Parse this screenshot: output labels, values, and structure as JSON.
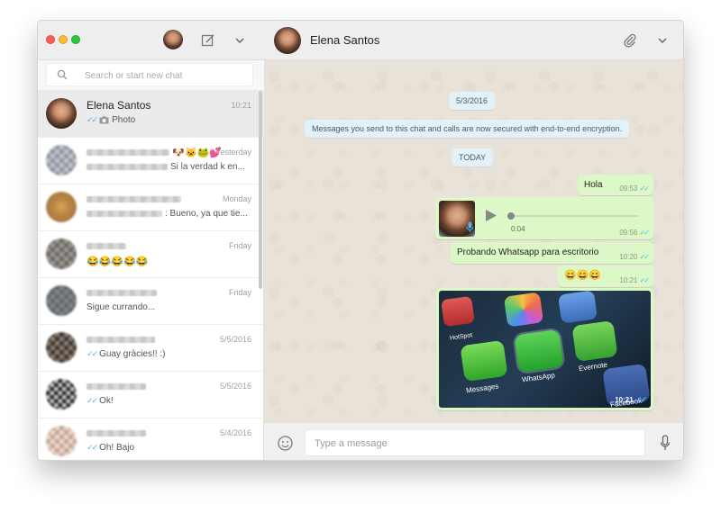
{
  "search": {
    "placeholder": "Search or start new chat"
  },
  "chats": [
    {
      "name": "Elena Santos",
      "time": "10:21",
      "preview": "Photo",
      "ticks": "✓✓",
      "has_photo_icon": true
    },
    {
      "name": "",
      "time": "Yesterday",
      "preview": "Si la verdad k en...",
      "ticks": "",
      "emojis": "🐶🐱🐸💕"
    },
    {
      "name": "",
      "time": "Monday",
      "preview": ": Bueno, ya que tie...",
      "ticks": ""
    },
    {
      "name": "",
      "time": "Friday",
      "preview": "😂😂😂😂😂",
      "ticks": ""
    },
    {
      "name": "",
      "time": "Friday",
      "preview": "Sigue currando...",
      "ticks": ""
    },
    {
      "name": "",
      "time": "5/5/2016",
      "preview": "Guay gràcies!! :)",
      "ticks": "✓✓"
    },
    {
      "name": "",
      "time": "5/5/2016",
      "preview": "Ok!",
      "ticks": "✓✓"
    },
    {
      "name": "",
      "time": "5/4/2016",
      "preview": "Oh! Bajo",
      "ticks": "✓✓"
    }
  ],
  "conversation": {
    "contact_name": "Elena Santos",
    "date_pill": "5/3/2016",
    "encryption_notice": "Messages you send to this chat and calls are now secured with end-to-end encryption.",
    "today_pill": "TODAY",
    "messages": [
      {
        "text": "Hola",
        "time": "09:53"
      },
      {
        "voice_duration": "0:04",
        "time": "09:56"
      },
      {
        "text": "Probando Whatsapp para escritorio",
        "time": "10:20"
      },
      {
        "text": "😄😄😄",
        "time": "10:21"
      },
      {
        "photo_time": "10:21",
        "app_labels": [
          "HotSpot",
          "Messages",
          "WhatsApp",
          "Evernote",
          "Facebook"
        ]
      }
    ]
  },
  "composer": {
    "placeholder": "Type a message"
  },
  "colors": {
    "bubble_out": "#dcf8c6",
    "tick_blue": "#4fb6ec",
    "pill_bg": "#e1f2fb"
  }
}
